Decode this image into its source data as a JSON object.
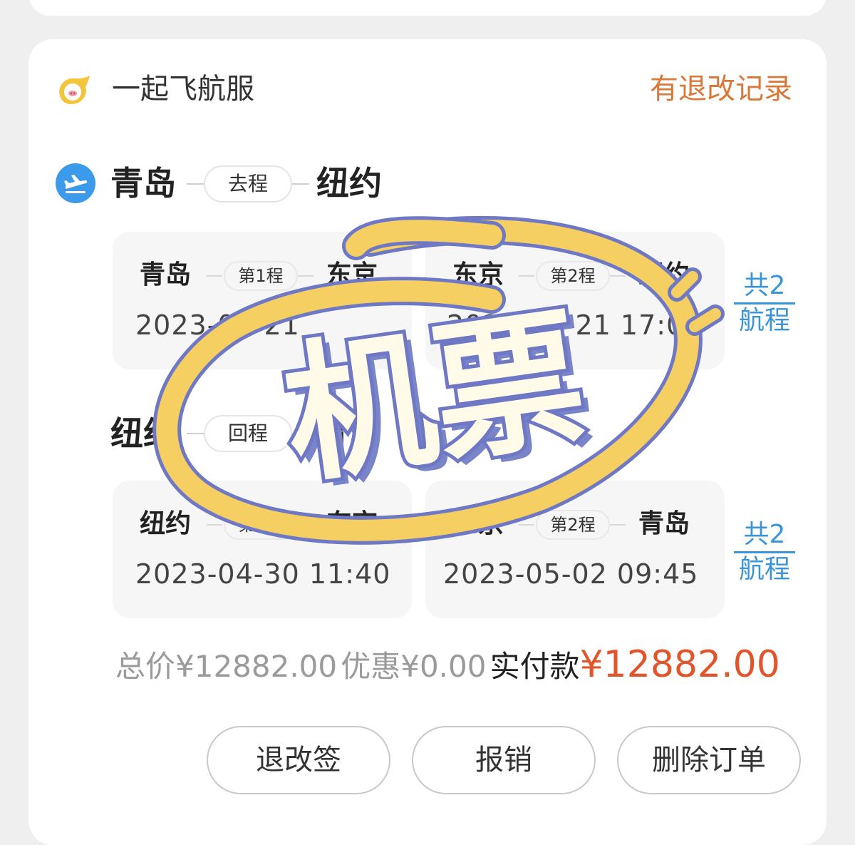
{
  "brand": {
    "name": "一起飞航服",
    "refund_record_link": "有退改记录",
    "logo_icon": "pig-logo-icon"
  },
  "outbound": {
    "from": "青岛",
    "trip_label": "去程",
    "to": "纽约",
    "segments": [
      {
        "from": "青岛",
        "label": "第1程",
        "to": "东京",
        "time": "2023-04-21"
      },
      {
        "from": "东京",
        "label": "第2程",
        "to": "纽约",
        "time": "2023-04-21 17:00"
      }
    ],
    "total_link": {
      "line1": "共2",
      "line2": "航程"
    }
  },
  "return": {
    "from": "纽约",
    "trip_label": "回程",
    "to": "青岛",
    "segments": [
      {
        "from": "纽约",
        "label": "第1程",
        "to": "东京",
        "time": "2023-04-30 11:40"
      },
      {
        "from": "东京",
        "label": "第2程",
        "to": "青岛",
        "time": "2023-05-02 09:45"
      }
    ],
    "total_link": {
      "line1": "共2",
      "line2": "航程"
    }
  },
  "price": {
    "total": "总价¥12882.00",
    "discount": "优惠¥0.00",
    "paid_label": "实付款",
    "paid_amount": "¥12882.00"
  },
  "actions": {
    "change": "退改签",
    "reimburse": "报销",
    "delete": "删除订单"
  },
  "sticker": {
    "text": "机票"
  },
  "colors": {
    "accent_orange": "#d8783a",
    "price_red": "#e2542a",
    "link_blue": "#3a95d8",
    "plane_blue": "#3b9bea",
    "sticker_yellow": "#f6cf63",
    "sticker_purple": "#6e78c4"
  }
}
